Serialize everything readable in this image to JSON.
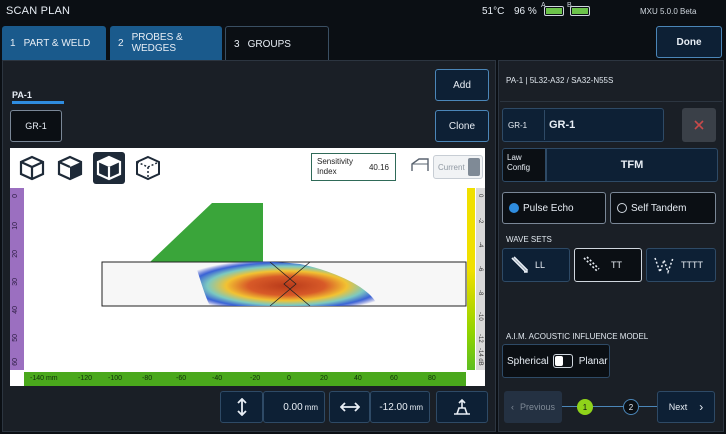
{
  "header": {
    "title": "SCAN PLAN",
    "temperature": "51°C",
    "battery_percent": "96 %",
    "battery_a_label": "A",
    "battery_b_label": "B",
    "version": "MXU 5.0.0 Beta"
  },
  "tabs": [
    {
      "num": "1",
      "label": "PART & WELD"
    },
    {
      "num": "2",
      "label": "PROBES & WEDGES"
    },
    {
      "num": "3",
      "label": "GROUPS"
    }
  ],
  "done_label": "Done",
  "left": {
    "probe_tab": "PA-1",
    "group_chip": "GR-1",
    "add_label": "Add",
    "clone_label": "Clone",
    "sensitivity_label": "Sensitivity Index",
    "sensitivity_value": "40.16",
    "current_label": "Current",
    "bottom_ticks": [
      "-140 mm",
      "-120",
      "-100",
      "-80",
      "-60",
      "-40",
      "-20",
      "0",
      "20",
      "40",
      "60",
      "80"
    ],
    "left_ticks": [
      "0",
      "10",
      "20",
      "30",
      "40",
      "50",
      "60"
    ],
    "right_ticks": [
      "0",
      "-2",
      "-4",
      "-6",
      "-8",
      "-10",
      "-12",
      "-14 dB"
    ],
    "vertical_offset": "0.00",
    "vertical_unit": "mm",
    "horizontal_offset": "-12.00",
    "horizontal_unit": "mm"
  },
  "right": {
    "probe_title": "PA-1 | 5L32-A32 / SA32-N55S",
    "group_field_label": "GR-1",
    "group_name": "GR-1",
    "law_config_label": "Law Config",
    "law_config_value": "TFM",
    "pulse_echo": "Pulse Echo",
    "self_tandem": "Self Tandem",
    "wave_sets_title": "WAVE SETS",
    "wave_sets": [
      "LL",
      "TT",
      "TTTT"
    ],
    "aim_title": "A.I.M. ACOUSTIC INFLUENCE MODEL",
    "aim_left": "Spherical",
    "aim_right": "Planar",
    "previous": "Previous",
    "next": "Next",
    "step1": "1",
    "step2": "2"
  },
  "colors": {
    "accent": "#2f8de0",
    "tab_blue": "#1a5a8c",
    "wedge_green": "#3aa53a",
    "battery_green": "#6cc24a",
    "step_active": "#8fd31a"
  }
}
